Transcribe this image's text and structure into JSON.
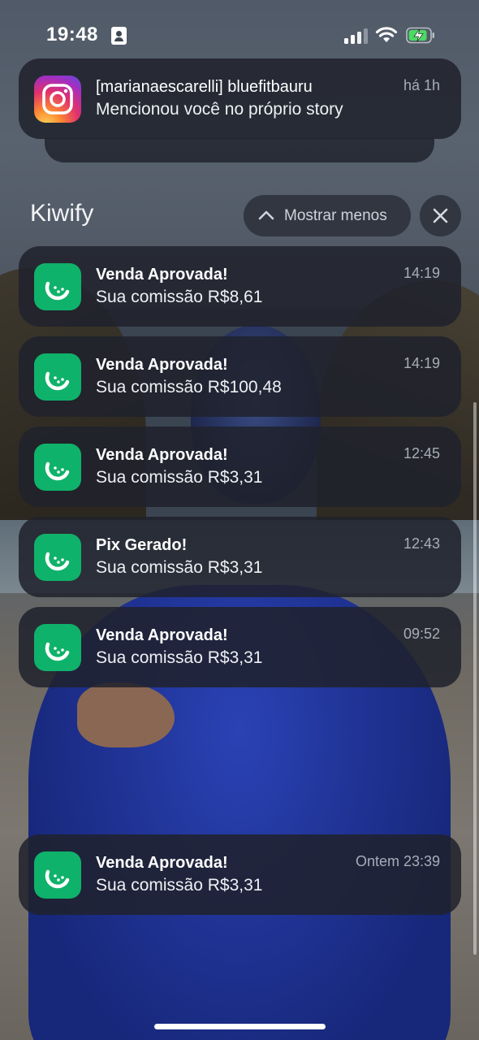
{
  "status_bar": {
    "time": "19:48",
    "icons": [
      "id-card-icon",
      "cellular-signal-icon",
      "wifi-icon",
      "battery-charging-icon"
    ],
    "battery_color": "#4cd964"
  },
  "instagram_notification": {
    "icon": "instagram-icon",
    "title": "[marianaescarelli] bluefitbauru",
    "body": "Mencionou você no próprio story",
    "time": "há 1h"
  },
  "group": {
    "app_name": "Kiwify",
    "show_less_label": "Mostrar menos",
    "show_less_icon": "chevron-up-icon",
    "close_icon": "close-icon"
  },
  "notifications": [
    {
      "title": "Venda Aprovada!",
      "body": "Sua comissão R$8,61",
      "time": "14:19"
    },
    {
      "title": "Venda Aprovada!",
      "body": "Sua comissão R$100,48",
      "time": "14:19"
    },
    {
      "title": "Venda Aprovada!",
      "body": "Sua comissão R$3,31",
      "time": "12:45"
    },
    {
      "title": "Pix Gerado!",
      "body": "Sua comissão R$3,31",
      "time": "12:43"
    },
    {
      "title": "Venda Aprovada!",
      "body": "Sua comissão R$3,31",
      "time": "09:52"
    },
    {
      "title": "Venda Aprovada!",
      "body": "Sua comissão R$3,31",
      "time": "Ontem 23:39"
    }
  ],
  "colors": {
    "kiwify_brand": "#0fb26a"
  }
}
